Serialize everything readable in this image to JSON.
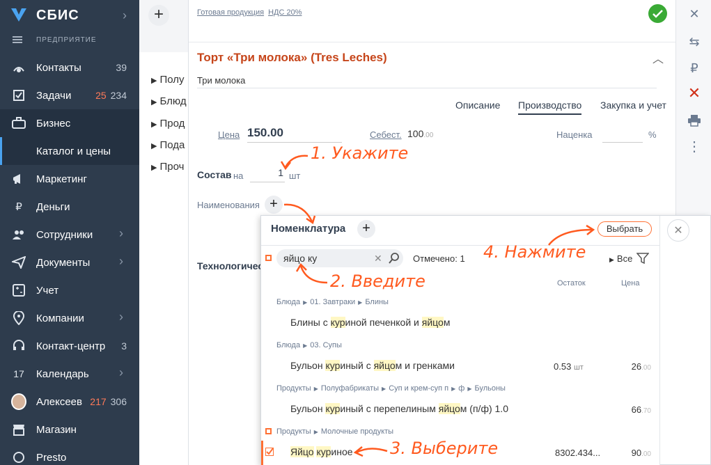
{
  "sidebar": {
    "brand": "СБИС",
    "sub_brand": "ПРЕДПРИЯТИЕ",
    "items": [
      {
        "label": "Контакты",
        "count": "39"
      },
      {
        "label": "Задачи",
        "count_red": "25",
        "count": "234"
      },
      {
        "label": "Бизнес"
      },
      {
        "label": "Каталог и цены"
      },
      {
        "label": "Маркетинг"
      },
      {
        "label": "Деньги"
      },
      {
        "label": "Сотрудники"
      },
      {
        "label": "Документы"
      },
      {
        "label": "Учет"
      },
      {
        "label": "Компании"
      },
      {
        "label": "Контакт-центр",
        "count": "3"
      },
      {
        "label": "Календарь",
        "icon_text": "17"
      },
      {
        "label": "Алексеев",
        "count_red": "217",
        "count": "306"
      },
      {
        "label": "Магазин"
      },
      {
        "label": "Presto"
      }
    ]
  },
  "middle": {
    "rows": [
      "Полу",
      "Блюд",
      "Прод",
      "Пода",
      "Проч"
    ]
  },
  "card": {
    "breadcrumbs": [
      "Готовая продукция",
      "НДС 20%"
    ],
    "title": "Торт «Три молока» (Tres Leches)",
    "subtitle": "Три молока",
    "tabs": [
      "Описание",
      "Производство",
      "Закупка и учет"
    ],
    "price_label": "Цена",
    "price_value": "150.00",
    "cost_label": "Себест.",
    "cost_value": "100",
    "cost_decimals": ".00",
    "markup_label": "Наценка",
    "percent": "%",
    "sostav_label": "Состав",
    "sostav_na": "на",
    "sostav_qty": "1",
    "sostav_unit": "шт",
    "names_label": "Наименования",
    "techno_label": "Технологичес"
  },
  "popup": {
    "title": "Номенклатура",
    "select_button": "Выбрать",
    "search_value": "яйцо ку",
    "marked": "Отмечено: 1",
    "all_label": "Все",
    "col_rest": "Остаток",
    "col_price": "Цена",
    "groups": [
      {
        "path": [
          "Блюда",
          "01. Завтраки",
          "Блины"
        ],
        "name_parts": [
          "Блины с ",
          "кур",
          "иной печенкой и ",
          "яйцо",
          "м"
        ],
        "rest": "",
        "rest_unit": "",
        "price": "",
        "price_dec": ""
      },
      {
        "path": [
          "Блюда",
          "03. Супы"
        ],
        "name_parts": [
          "Бульон ",
          "кур",
          "иный с ",
          "яйцо",
          "м и гренками"
        ],
        "rest": "0.53",
        "rest_unit": "шт",
        "price": "26",
        "price_dec": ".00"
      },
      {
        "path": [
          "Продукты",
          "Полуфабрикаты",
          "Суп и крем-суп п",
          "ф",
          "Бульоны"
        ],
        "name_parts": [
          "Бульон ",
          "кур",
          "иный с перепелиным ",
          "яйцо",
          "м (п/ф) 1.0"
        ],
        "rest": "",
        "rest_unit": "",
        "price": "66",
        "price_dec": ".70"
      },
      {
        "path": [
          "Продукты",
          "Молочные продукты"
        ],
        "name_parts": [
          "",
          "Яйцо",
          " ",
          "кур",
          "иное"
        ],
        "rest": "8302.434...",
        "rest_unit": "",
        "price": "90",
        "price_dec": ".00"
      }
    ]
  },
  "annotations": {
    "a1": "1. Укажите",
    "a2": "2. Введите",
    "a3": "3. Выберите",
    "a4": "4. Нажмите"
  },
  "colors": {
    "sidebar_bg": "#2e3c4d",
    "accent_orange": "#ff7033",
    "title_red": "#c6451a",
    "ok_green": "#3aaa35"
  }
}
